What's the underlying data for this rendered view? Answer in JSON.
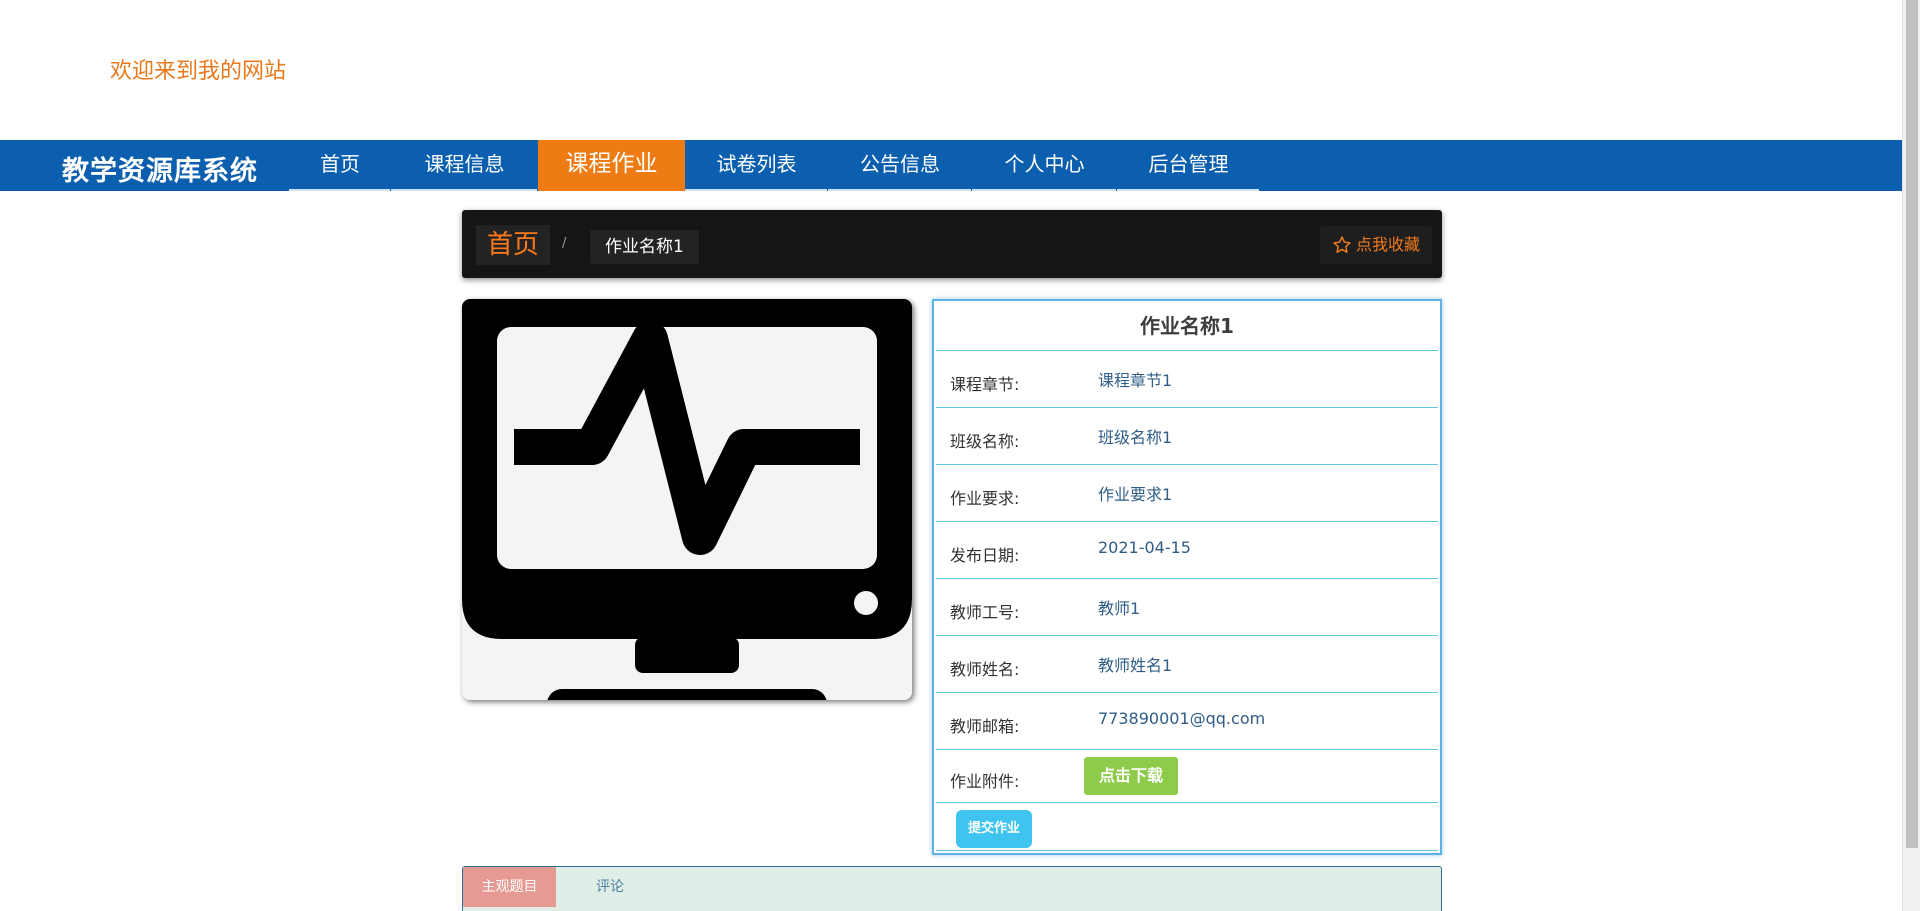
{
  "header": {
    "welcome": "欢迎来到我的网站"
  },
  "navbar": {
    "brand": "教学资源库系统",
    "items": [
      {
        "label": "首页"
      },
      {
        "label": "课程信息"
      },
      {
        "label": "课程作业",
        "active": true
      },
      {
        "label": "试卷列表"
      },
      {
        "label": "公告信息"
      },
      {
        "label": "个人中心"
      },
      {
        "label": "后台管理"
      }
    ]
  },
  "breadcrumb": {
    "home": "首页",
    "separator": "/",
    "current": "作业名称1",
    "favorite": "点我收藏"
  },
  "detail": {
    "title": "作业名称1",
    "rows": [
      {
        "label": "课程章节:",
        "value": "课程章节1"
      },
      {
        "label": "班级名称:",
        "value": "班级名称1"
      },
      {
        "label": "作业要求:",
        "value": "作业要求1"
      },
      {
        "label": "发布日期:",
        "value": "2021-04-15"
      },
      {
        "label": "教师工号:",
        "value": "教师1"
      },
      {
        "label": "教师姓名:",
        "value": "教师姓名1"
      },
      {
        "label": "教师邮箱:",
        "value": "773890001@qq.com"
      }
    ],
    "attachment_label": "作业附件:",
    "download_label": "点击下载",
    "submit_label": "提交作业"
  },
  "tabs": {
    "active": "主观题目",
    "comment": "评论"
  },
  "colors": {
    "nav": "#0b5fae",
    "accent": "#ee7b13",
    "download": "#8fcb4b",
    "submit": "#3fc4ef"
  },
  "icons": {
    "image": "monitor-heartbeat-icon",
    "favorite": "star-outline-icon"
  }
}
